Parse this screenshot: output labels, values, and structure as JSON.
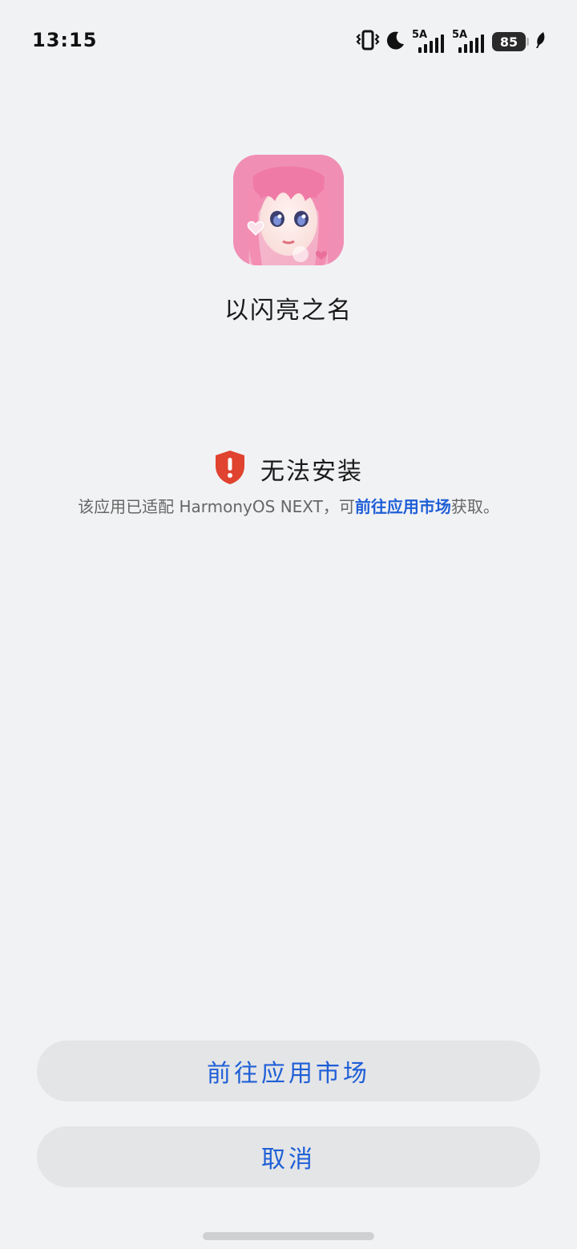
{
  "status_bar": {
    "time": "13:15",
    "signal_1_label": "5A",
    "signal_2_label": "5A",
    "battery_level": "85",
    "icons": [
      "vibrate-icon",
      "moon-icon",
      "signal-icon",
      "signal-icon",
      "battery-icon",
      "leaf-icon"
    ]
  },
  "app": {
    "name": "以闪亮之名",
    "icon": "app-icon-anime-girl"
  },
  "warning": {
    "title": "无法安装",
    "desc_prefix": "该应用已适配 HarmonyOS NEXT，可",
    "desc_link": "前往应用市场",
    "desc_suffix": "获取。",
    "icon": "shield-alert-icon",
    "icon_color": "#e0432f"
  },
  "buttons": {
    "market_label": "前往应用市场",
    "cancel_label": "取消"
  },
  "colors": {
    "background": "#f1f2f4",
    "accent": "#1f5fd6",
    "button_bg": "#e4e5e7"
  }
}
